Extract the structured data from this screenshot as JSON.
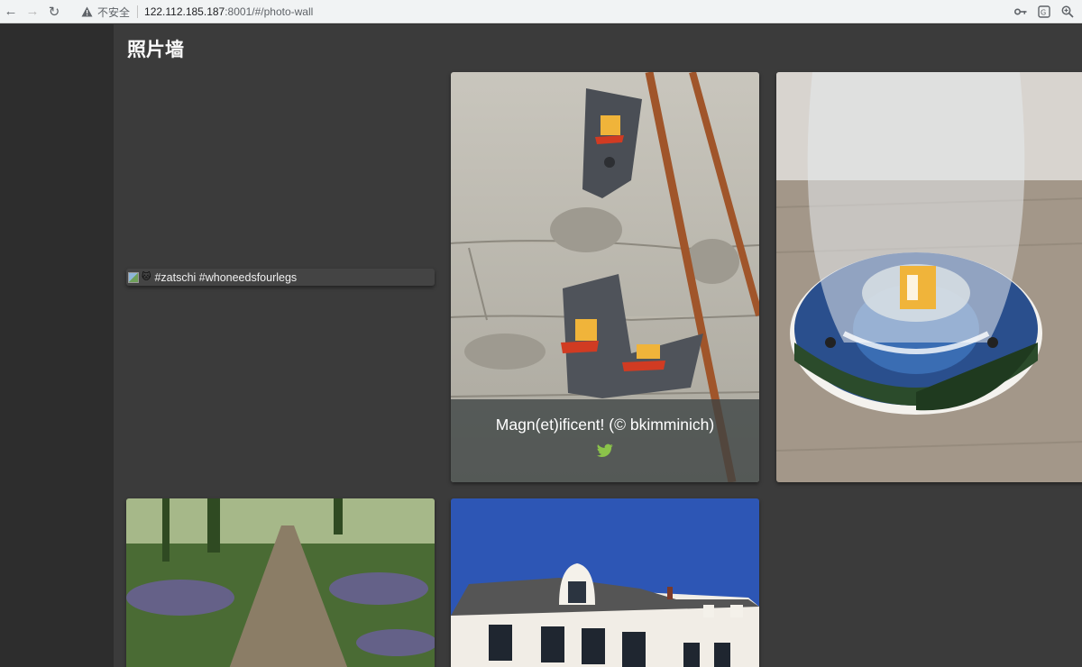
{
  "browser": {
    "security_label": "不安全",
    "url_host": "122.112.185.187",
    "url_rest": ":8001/#/photo-wall"
  },
  "page": {
    "title": "照片墙"
  },
  "photos": [
    {
      "caption": "#zatschi #whoneedsfourlegs",
      "emoji": "🐱",
      "image_broken": true
    },
    {
      "caption": "Magn(et)ificent! (© bkimminich)",
      "share_icon": "twitter-icon",
      "accent": "#8bc34a"
    },
    {
      "caption": "",
      "icon": "coaster-glass"
    },
    {
      "caption": "",
      "icon": "forest-path"
    },
    {
      "caption": "",
      "icon": "building"
    }
  ]
}
